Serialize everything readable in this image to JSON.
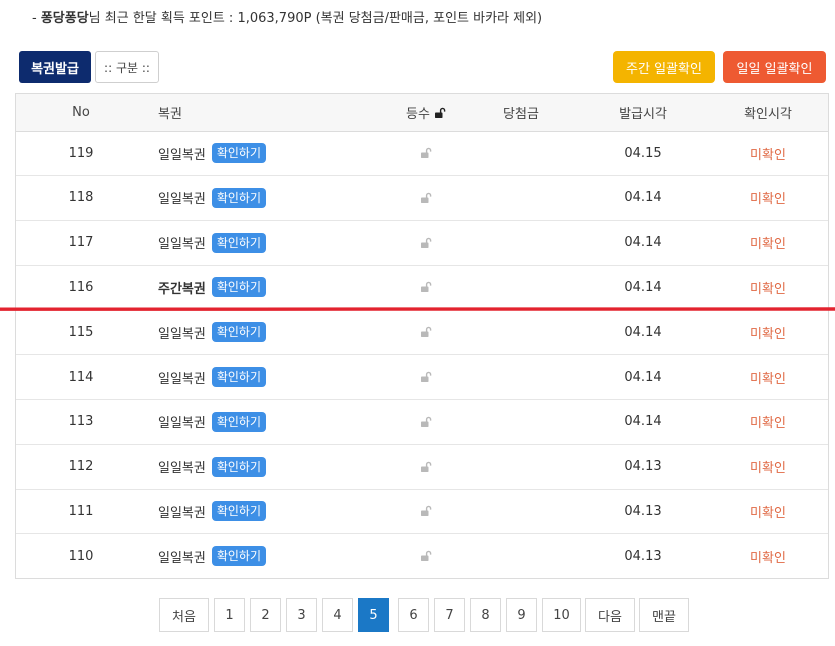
{
  "summary": {
    "prefix": "- ",
    "user": "퐁당퐁당",
    "text": "님 최근 한달 획득 포인트 : 1,063,790P (복권 당첨금/판매금, 포인트 바카라 제외)"
  },
  "toolbar": {
    "issue_label": "복권발급",
    "category_label": ":: 구분 ::",
    "weekly_confirm_label": "주간 일괄확인",
    "daily_confirm_label": "일일 일괄확인"
  },
  "table": {
    "headers": {
      "no": "No",
      "ticket": "복권",
      "rank": "등수",
      "prize": "당첨금",
      "issued": "발급시각",
      "checked": "확인시각"
    },
    "rows": [
      {
        "no": "119",
        "ticket": "일일복권",
        "bold": false,
        "button": "확인하기",
        "prize": "",
        "issued": "04.15",
        "checked": "미확인"
      },
      {
        "no": "118",
        "ticket": "일일복권",
        "bold": false,
        "button": "확인하기",
        "prize": "",
        "issued": "04.14",
        "checked": "미확인"
      },
      {
        "no": "117",
        "ticket": "일일복권",
        "bold": false,
        "button": "확인하기",
        "prize": "",
        "issued": "04.14",
        "checked": "미확인"
      },
      {
        "no": "116",
        "ticket": "주간복권",
        "bold": true,
        "button": "확인하기",
        "prize": "",
        "issued": "04.14",
        "checked": "미확인"
      },
      {
        "no": "115",
        "ticket": "일일복권",
        "bold": false,
        "button": "확인하기",
        "prize": "",
        "issued": "04.14",
        "checked": "미확인"
      },
      {
        "no": "114",
        "ticket": "일일복권",
        "bold": false,
        "button": "확인하기",
        "prize": "",
        "issued": "04.14",
        "checked": "미확인"
      },
      {
        "no": "113",
        "ticket": "일일복권",
        "bold": false,
        "button": "확인하기",
        "prize": "",
        "issued": "04.14",
        "checked": "미확인"
      },
      {
        "no": "112",
        "ticket": "일일복권",
        "bold": false,
        "button": "확인하기",
        "prize": "",
        "issued": "04.13",
        "checked": "미확인"
      },
      {
        "no": "111",
        "ticket": "일일복권",
        "bold": false,
        "button": "확인하기",
        "prize": "",
        "issued": "04.13",
        "checked": "미확인"
      },
      {
        "no": "110",
        "ticket": "일일복권",
        "bold": false,
        "button": "확인하기",
        "prize": "",
        "issued": "04.13",
        "checked": "미확인"
      }
    ]
  },
  "pagination": {
    "first": "처음",
    "pages": [
      "1",
      "2",
      "3",
      "4",
      "5",
      "6",
      "7",
      "8",
      "9",
      "10"
    ],
    "current": "5",
    "next": "다음",
    "last": "맨끝"
  },
  "colors": {
    "navy": "#0d2b6e",
    "weekly": "#f4b400",
    "daily": "#ee5a32",
    "confirm": "#3d8fe6",
    "unconfirmed": "#e06a45",
    "active_page": "#1b78c6",
    "annotation_line": "#e3232f"
  },
  "icons": {
    "lock": "lock-open-icon"
  }
}
